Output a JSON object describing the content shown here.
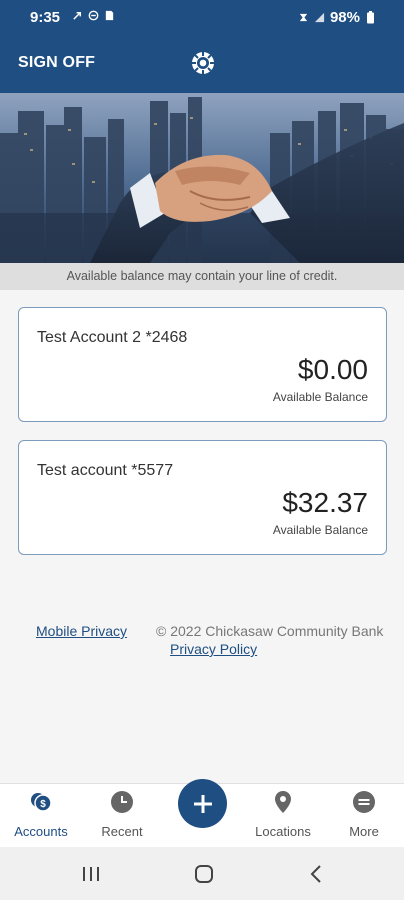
{
  "status_bar": {
    "time": "9:35",
    "battery": "98%"
  },
  "header": {
    "sign_off": "SIGN OFF"
  },
  "notice": "Available balance may contain your line of credit.",
  "accounts": [
    {
      "name": "Test Account 2 *2468",
      "balance": "$0.00",
      "caption": "Available Balance"
    },
    {
      "name": "Test account *5577",
      "balance": "$32.37",
      "caption": "Available Balance"
    }
  ],
  "footer": {
    "mobile_privacy": "Mobile Privacy",
    "copyright": "© 2022 Chickasaw Community Bank",
    "privacy_policy": "Privacy Policy"
  },
  "nav": {
    "items": [
      {
        "label": "Accounts",
        "icon": "accounts-icon",
        "active": true
      },
      {
        "label": "Recent",
        "icon": "clock-icon"
      },
      {
        "label": "Locations",
        "icon": "location-pin-icon"
      },
      {
        "label": "More",
        "icon": "more-icon"
      }
    ],
    "fab_icon": "plus-icon"
  },
  "colors": {
    "primary": "#1f4e82",
    "background": "#f5f5f5",
    "notice_bg": "#dedede"
  }
}
